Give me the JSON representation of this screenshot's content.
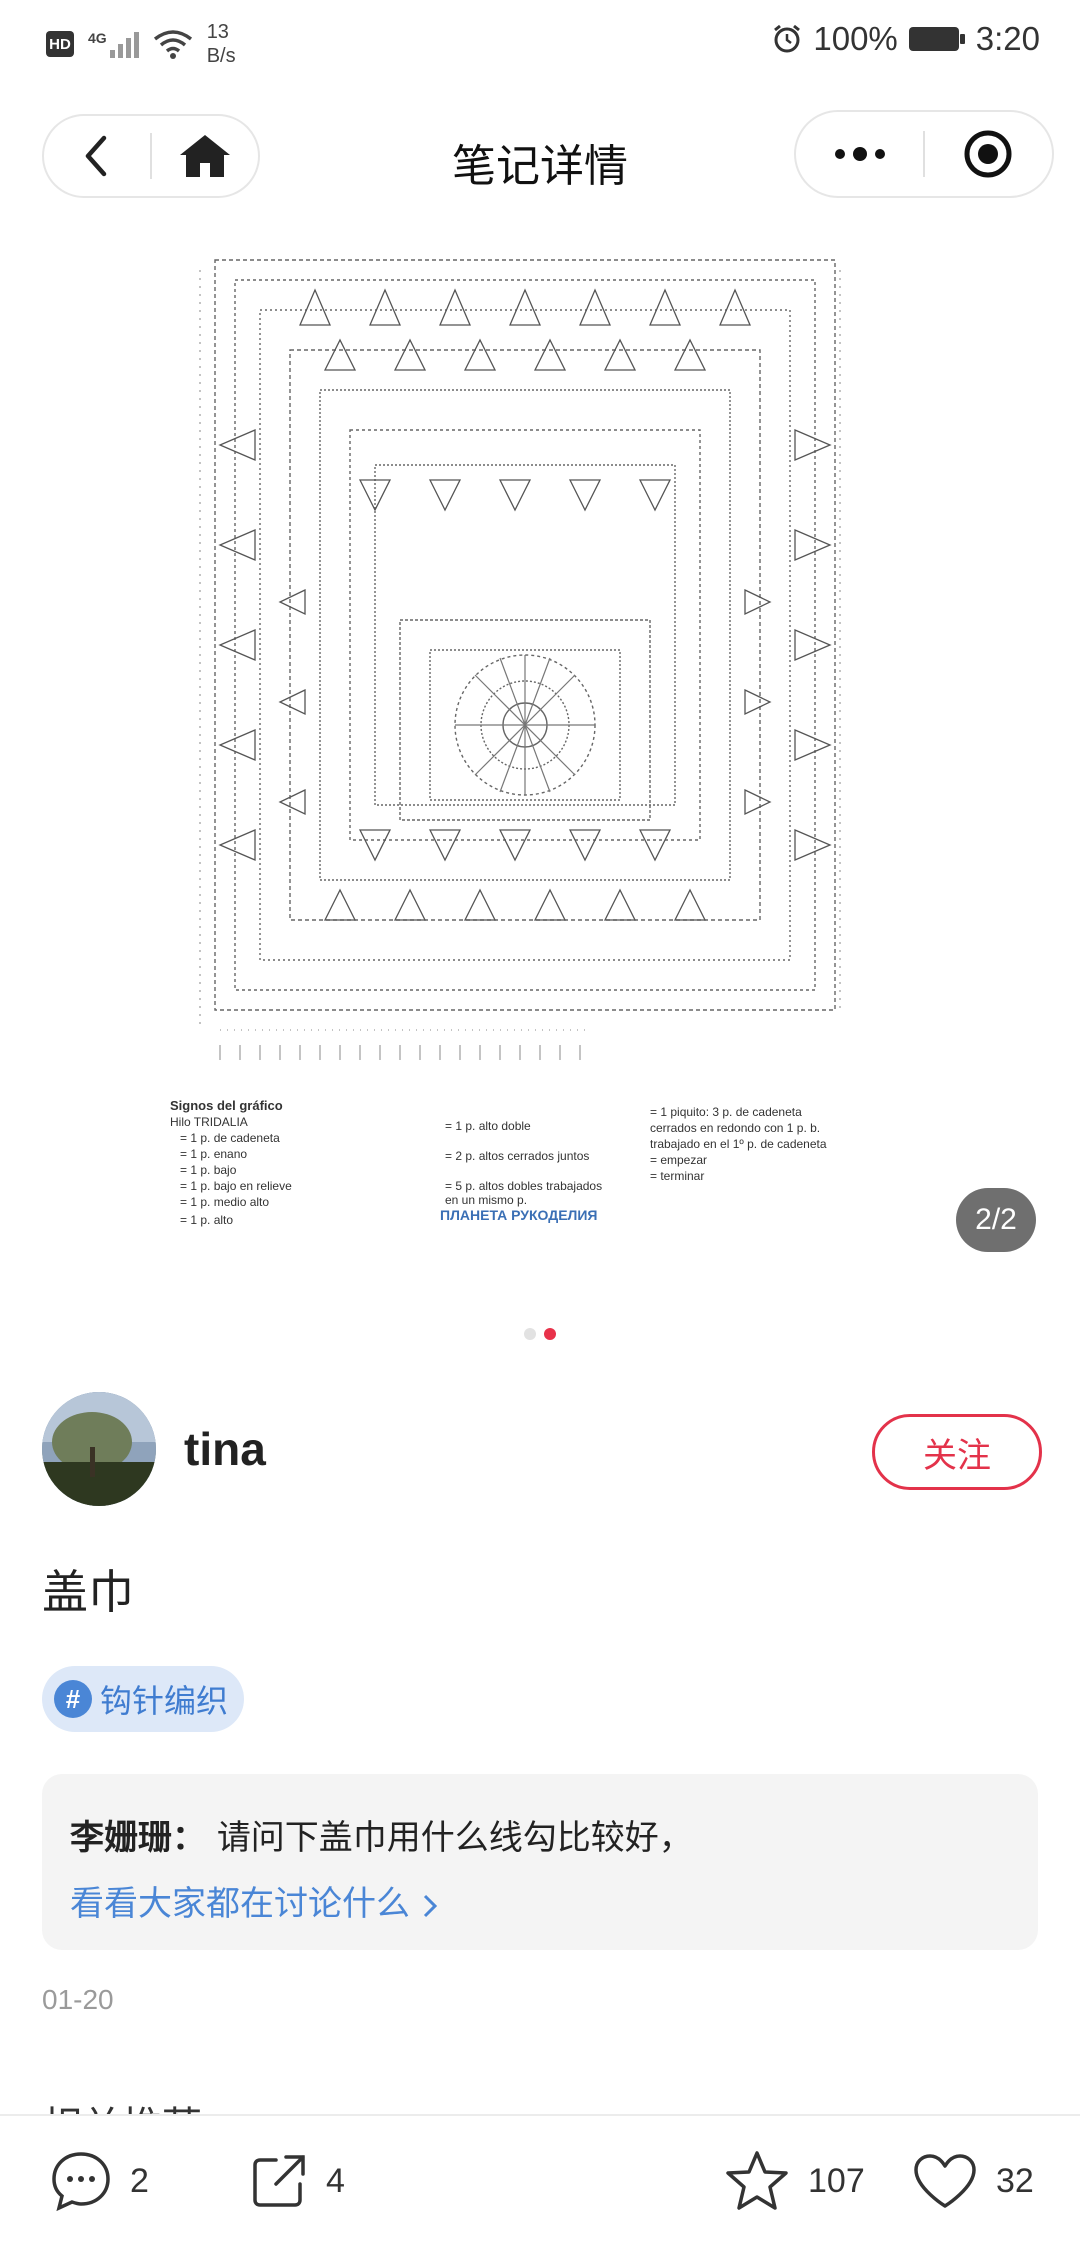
{
  "status_bar": {
    "hd": "HD",
    "network": "4G",
    "speed_value": "13",
    "speed_unit": "B/s",
    "battery": "100%",
    "time": "3:20"
  },
  "nav": {
    "title": "笔记详情",
    "icons": [
      "back-icon",
      "home-icon",
      "more-icon",
      "target-icon"
    ]
  },
  "gallery": {
    "page_indicator": "2/2",
    "legend": {
      "heading": "Signos del gráfico",
      "yarn": "Hilo TRIDALIA",
      "col1": [
        "= 1 p. de cadeneta",
        "= 1 p. enano",
        "= 1 p. bajo",
        "= 1 p. bajo en relieve",
        "= 1 p. medio alto",
        "= 1 p. alto"
      ],
      "col2": [
        "= 1 p. alto doble",
        "= 2 p. altos cerrados juntos",
        "= 5 p. altos dobles trabajados",
        "en un mismo p."
      ],
      "col3": [
        "= 1 piquito: 3 p. de cadeneta",
        "cerrados en redondo con 1 p. b.",
        "trabajado en el 1º p. de cadeneta",
        "= empezar",
        "= terminar"
      ],
      "watermark": "ПЛАНЕТА РУКОДЕЛИЯ"
    }
  },
  "author": {
    "name": "tina",
    "follow_label": "关注"
  },
  "note": {
    "title": "盖巾",
    "tag": "钩针编织",
    "date": "01-20"
  },
  "comment": {
    "author": "李姗珊：",
    "text": "请问下盖巾用什么线勾比较好，",
    "link": "看看大家都在讨论什么"
  },
  "related": {
    "title": "相关推荐"
  },
  "actions": {
    "comments": "2",
    "shares": "4",
    "favorites": "107",
    "likes": "32"
  },
  "colors": {
    "accent": "#e3324a",
    "link": "#4a86d6",
    "tag_bg": "#dde8f8"
  }
}
